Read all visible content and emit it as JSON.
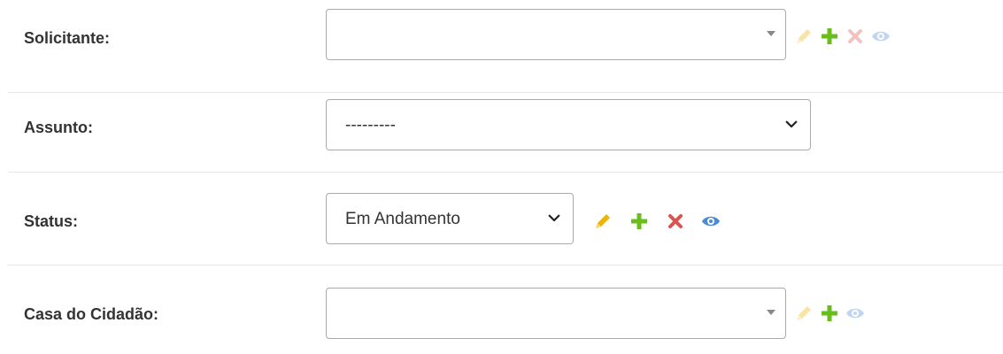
{
  "fields": {
    "solicitante": {
      "label": "Solicitante:",
      "value": ""
    },
    "assunto": {
      "label": "Assunto:",
      "value": "---------"
    },
    "status": {
      "label": "Status:",
      "value": "Em Andamento"
    },
    "casa": {
      "label": "Casa do Cidadão:",
      "value": ""
    }
  },
  "icons": {
    "edit": "pencil-icon",
    "add": "plus-icon",
    "delete": "x-icon",
    "view": "eye-icon"
  },
  "colors": {
    "edit": "#f0b400",
    "add": "#6abe1c",
    "delete": "#d9534f",
    "view": "#4a8ad6"
  }
}
